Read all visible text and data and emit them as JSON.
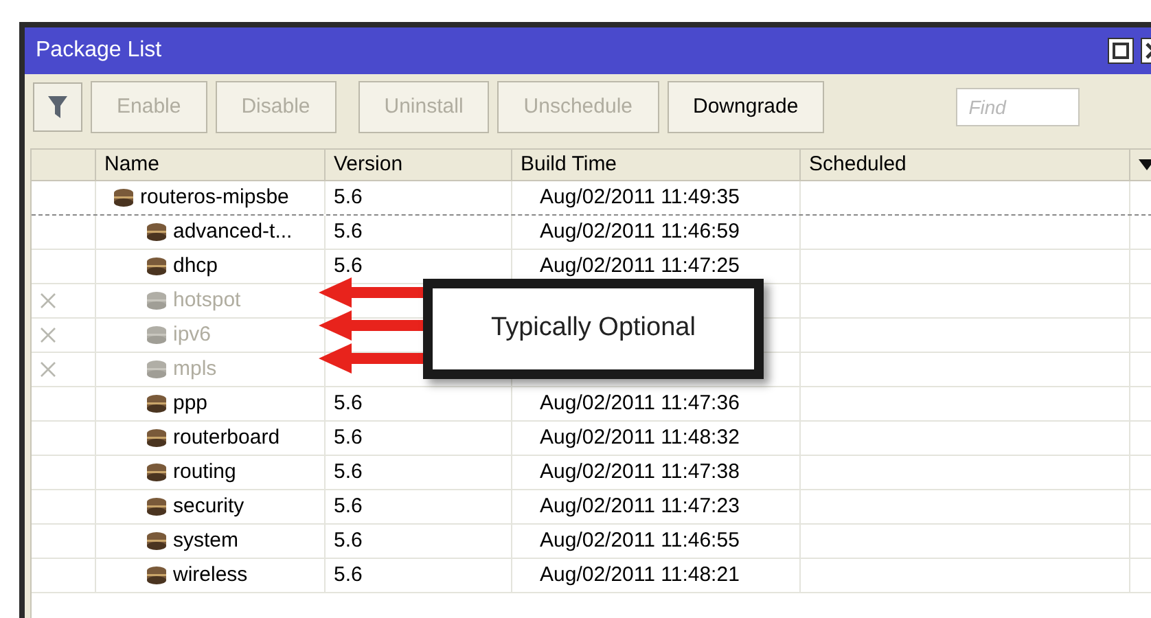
{
  "window": {
    "title": "Package List"
  },
  "toolbar": {
    "buttons": [
      {
        "label": "Enable",
        "disabled": true
      },
      {
        "label": "Disable",
        "disabled": true
      },
      {
        "label": "Uninstall",
        "disabled": true
      },
      {
        "label": "Unschedule",
        "disabled": true
      },
      {
        "label": "Downgrade",
        "disabled": false
      }
    ],
    "search": {
      "placeholder": "Find"
    }
  },
  "table": {
    "columns": [
      "Name",
      "Version",
      "Build Time",
      "Scheduled"
    ],
    "rows": [
      {
        "name": "routeros-mipsbe",
        "version": "5.6",
        "build_time": "Aug/02/2011 11:49:35",
        "disabled": false,
        "focused": true,
        "children": [
          {
            "name": "advanced-t...",
            "version": "5.6",
            "build_time": "Aug/02/2011 11:46:59",
            "disabled": false,
            "focused": false
          },
          {
            "name": "dhcp",
            "version": "5.6",
            "build_time": "Aug/02/2011 11:47:25",
            "disabled": false,
            "focused": false
          },
          {
            "name": "hotspot",
            "disabled": true,
            "focused": false
          },
          {
            "name": "ipv6",
            "disabled": true,
            "focused": false
          },
          {
            "name": "mpls",
            "disabled": true,
            "focused": false
          },
          {
            "name": "ppp",
            "version": "5.6",
            "build_time": "Aug/02/2011 11:47:36",
            "disabled": false,
            "focused": false
          },
          {
            "name": "routerboard",
            "version": "5.6",
            "build_time": "Aug/02/2011 11:48:32",
            "disabled": false,
            "focused": false
          },
          {
            "name": "routing",
            "version": "5.6",
            "build_time": "Aug/02/2011 11:47:38",
            "disabled": false,
            "focused": false
          },
          {
            "name": "security",
            "version": "5.6",
            "build_time": "Aug/02/2011 11:47:23",
            "disabled": false,
            "focused": false
          },
          {
            "name": "system",
            "version": "5.6",
            "build_time": "Aug/02/2011 11:46:55",
            "disabled": false,
            "focused": false
          },
          {
            "name": "wireless",
            "version": "5.6",
            "build_time": "Aug/02/2011 11:48:21",
            "disabled": false,
            "focused": false
          }
        ]
      }
    ]
  },
  "callout": {
    "text": "Typically Optional"
  }
}
